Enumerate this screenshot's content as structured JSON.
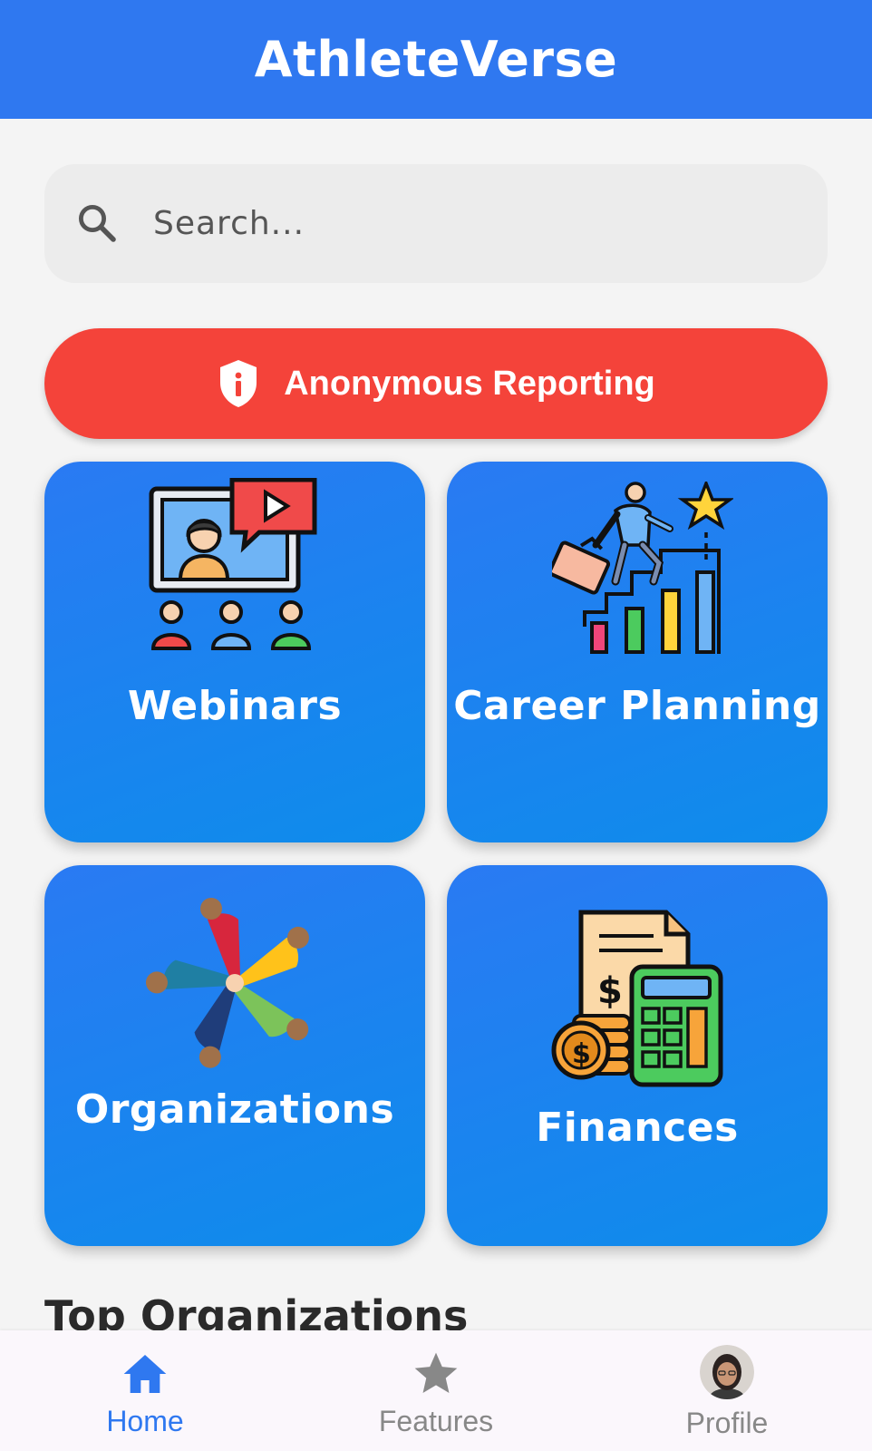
{
  "app": {
    "title": "AthleteVerse"
  },
  "search": {
    "placeholder": "Search...",
    "icon": "search-icon"
  },
  "report": {
    "label": "Anonymous Reporting",
    "icon": "shield-info-icon",
    "color": "#f4433a"
  },
  "cards": [
    {
      "label": "Webinars",
      "icon": "webinar-icon"
    },
    {
      "label": "Career Planning",
      "icon": "career-ladder-icon"
    },
    {
      "label": "Organizations",
      "icon": "team-circle-icon"
    },
    {
      "label": "Finances",
      "icon": "calculator-coins-icon"
    }
  ],
  "section": {
    "title": "Top Organizations"
  },
  "nav": {
    "items": [
      {
        "label": "Home",
        "icon": "home-icon",
        "active": true
      },
      {
        "label": "Features",
        "icon": "star-icon",
        "active": false
      },
      {
        "label": "Profile",
        "icon": "avatar",
        "active": false
      }
    ]
  },
  "colors": {
    "primary": "#2f78f0",
    "active_nav": "#2f78f0",
    "inactive_nav": "#888888"
  }
}
